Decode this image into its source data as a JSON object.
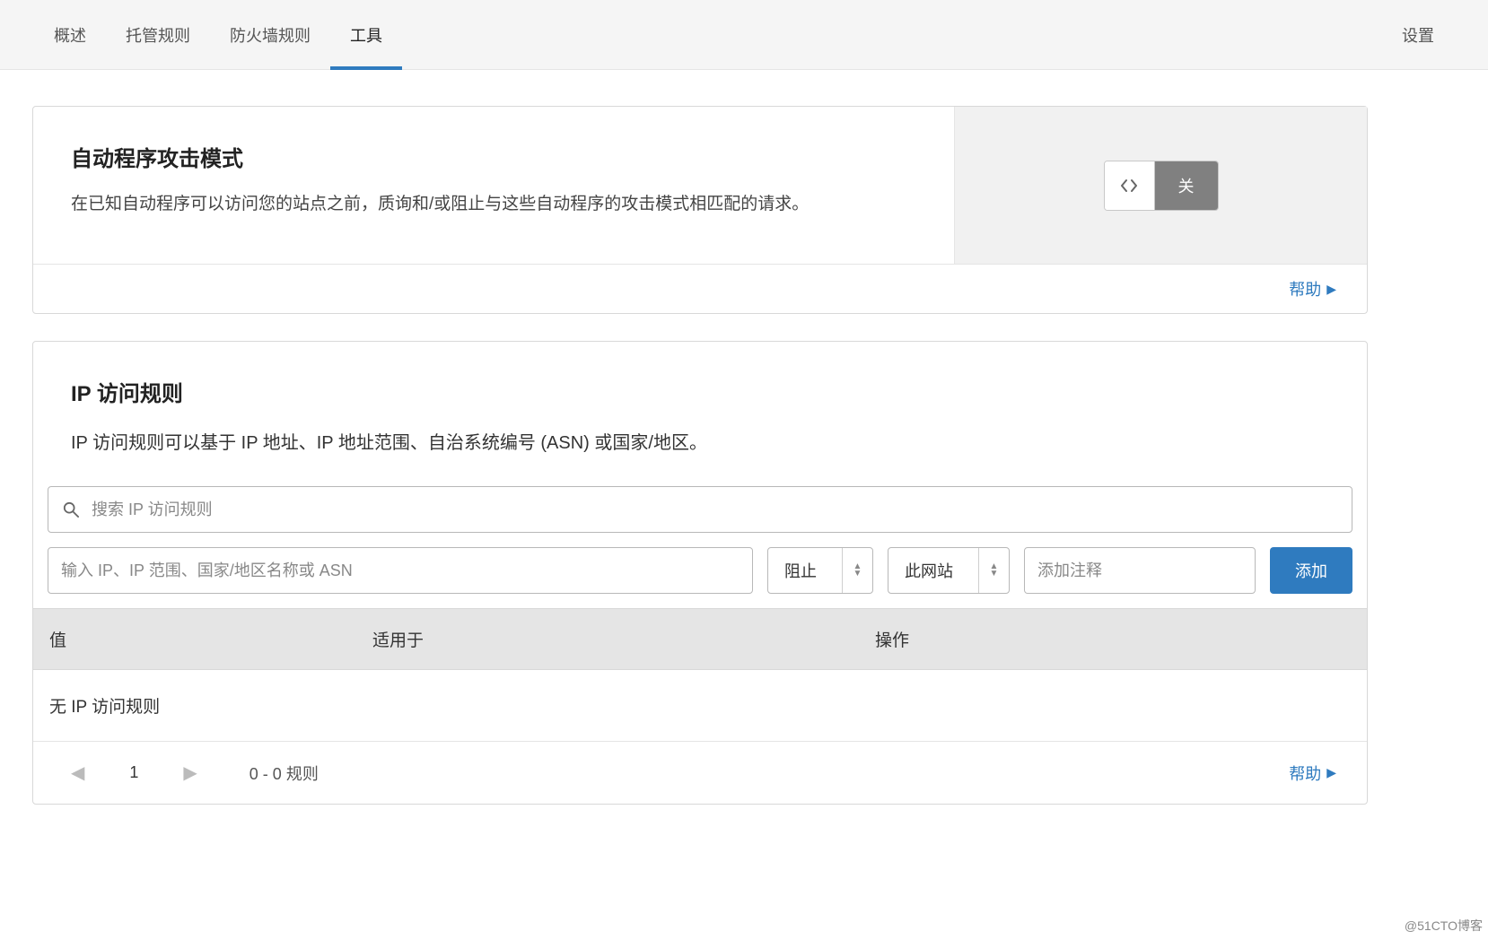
{
  "tabs": {
    "overview": "概述",
    "managed_rules": "托管规则",
    "firewall_rules": "防火墙规则",
    "tools": "工具",
    "settings": "设置"
  },
  "bot_card": {
    "title": "自动程序攻击模式",
    "desc": "在已知自动程序可以访问您的站点之前，质询和/或阻止与这些自动程序的攻击模式相匹配的请求。",
    "toggle_state": "关",
    "help": "帮助"
  },
  "ip_card": {
    "title": "IP 访问规则",
    "desc": "IP 访问规则可以基于 IP 地址、IP 地址范围、自治系统编号 (ASN) 或国家/地区。",
    "search_placeholder": "搜索 IP 访问规则",
    "value_placeholder": "输入 IP、IP 范围、国家/地区名称或 ASN",
    "action_select": "阻止",
    "scope_select": "此网站",
    "note_placeholder": "添加注释",
    "add_button": "添加",
    "headers": {
      "value": "值",
      "applies": "适用于",
      "op": "操作"
    },
    "empty": "无 IP 访问规则",
    "page_num": "1",
    "rule_count": "0 - 0 规则",
    "help": "帮助"
  },
  "watermark": "@51CTO博客"
}
